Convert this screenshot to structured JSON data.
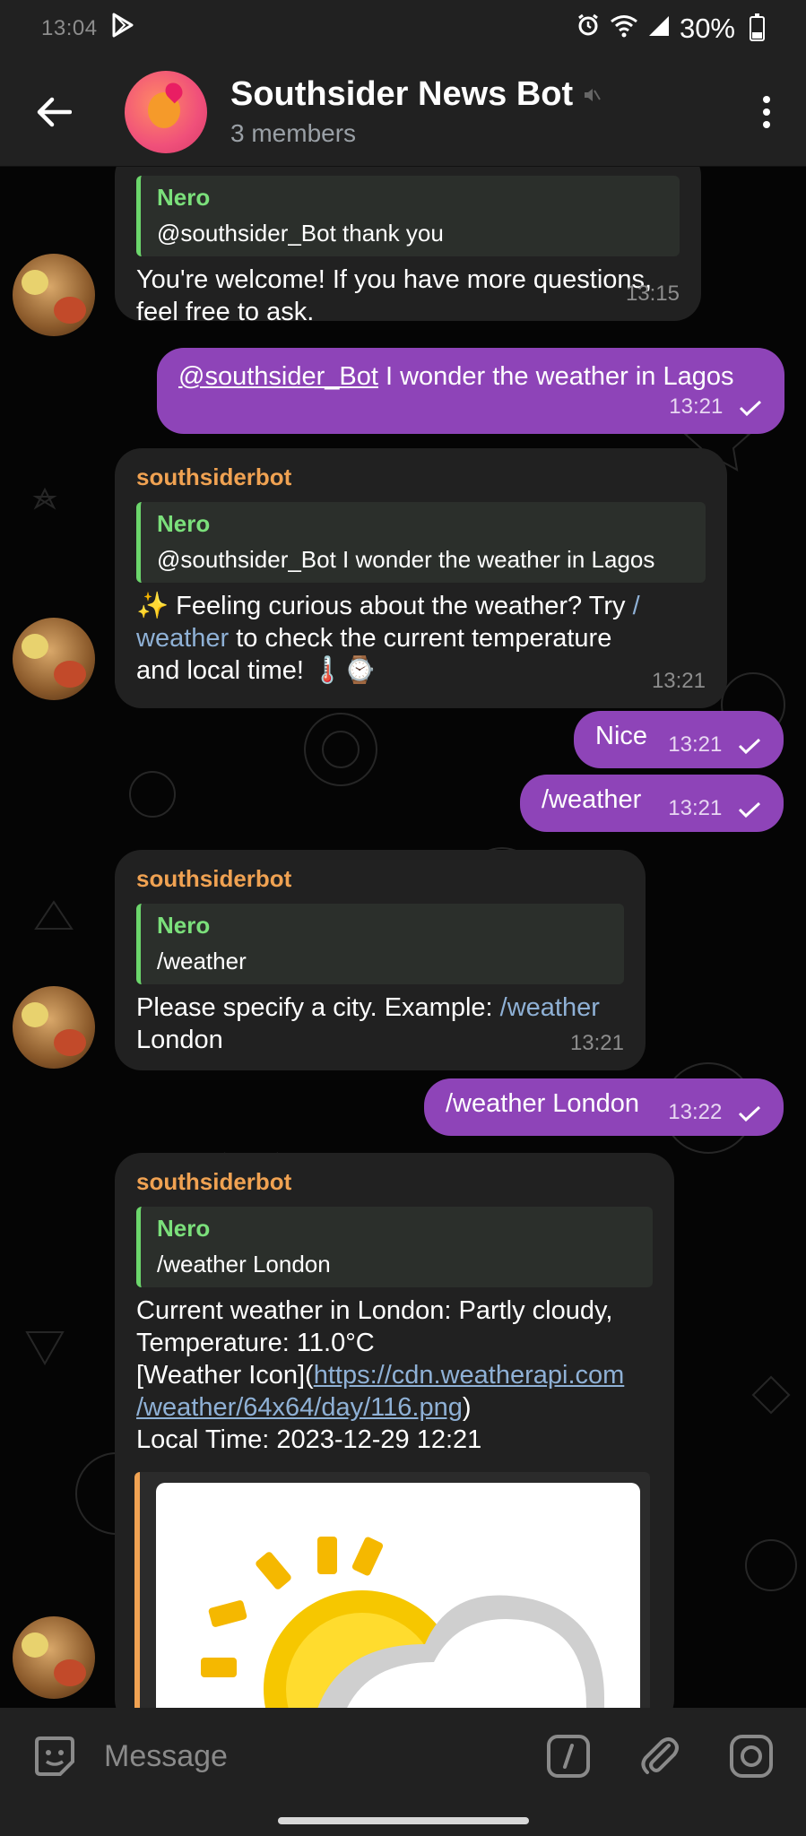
{
  "status_bar": {
    "time": "13:04",
    "battery": "30%",
    "icons": [
      "play-store-icon",
      "alarm-icon",
      "wifi-icon",
      "signal-icon",
      "battery-icon"
    ]
  },
  "header": {
    "title": "Southsider News Bot",
    "subtitle": "3 members",
    "muted": true
  },
  "messages": [
    {
      "direction": "in",
      "sender": "",
      "reply_name": "Nero",
      "reply_text": "@southsider_Bot thank you",
      "text_lines": [
        "You're welcome! If you have more questions,",
        "feel free to ask."
      ],
      "time": "13:15"
    },
    {
      "direction": "out",
      "mention": "@southsider_Bot",
      "text": " I wonder the weather in Lagos",
      "time": "13:21"
    },
    {
      "direction": "in",
      "sender": "southsiderbot",
      "reply_name": "Nero",
      "reply_text": "@southsider_Bot I wonder the weather in Lagos",
      "line1_prefix": "✨ Feeling curious about the weather? Try ",
      "line1_cmd": "/",
      "line2_cmd": "weather",
      "line2_rest": " to check the current temperature",
      "line3": "and local time! 🌡️⌚",
      "time": "13:21"
    },
    {
      "direction": "out",
      "text": "Nice",
      "time": "13:21"
    },
    {
      "direction": "out",
      "text": "/weather",
      "time": "13:21"
    },
    {
      "direction": "in",
      "sender": "southsiderbot",
      "reply_name": "Nero",
      "reply_text": "/weather",
      "line1_prefix": "Please specify a city. Example: ",
      "line1_cmd": "/weather",
      "line2": "London",
      "time": "13:21"
    },
    {
      "direction": "out",
      "text": "/weather London",
      "time": "13:22"
    },
    {
      "direction": "in",
      "sender": "southsiderbot",
      "reply_name": "Nero",
      "reply_text": "/weather London",
      "line1": "Current weather in London: Partly cloudy,",
      "line2": "Temperature: 11.0°C",
      "line3_prefix": "[Weather Icon](",
      "line3_link": "https://cdn.weatherapi.com",
      "line4_link": "/weather/64x64/day/116.png",
      "line4_suffix": ")",
      "line5": "Local Time: 2023-12-29 12:21"
    }
  ],
  "composer": {
    "placeholder": "Message"
  }
}
